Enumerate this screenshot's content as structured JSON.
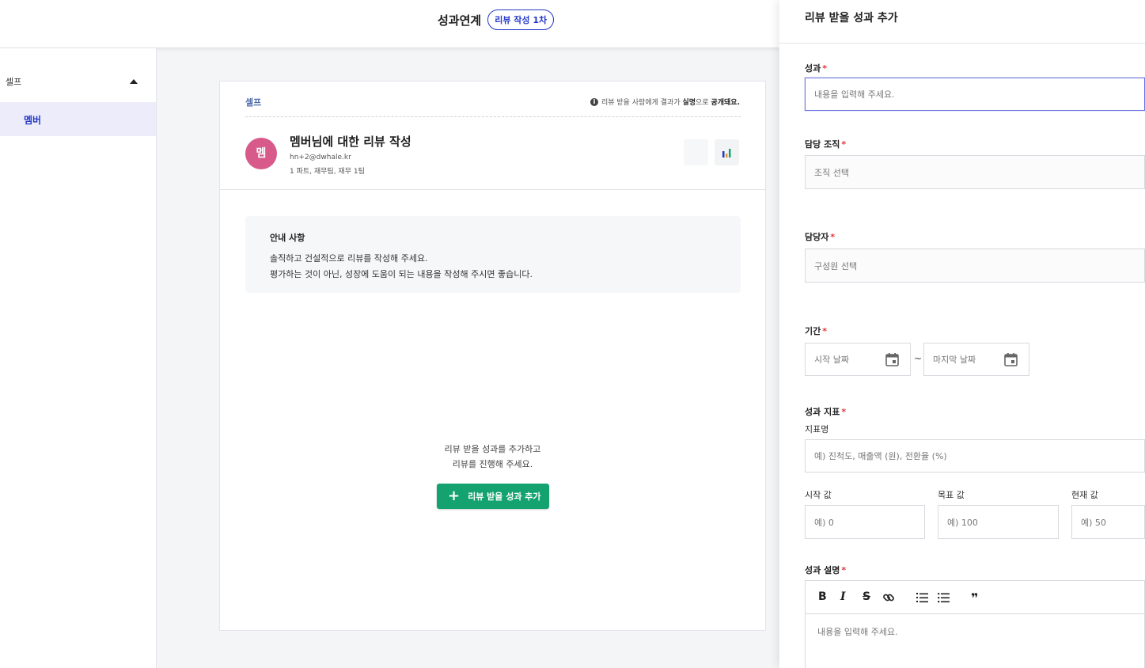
{
  "header": {
    "title": "성과연계",
    "badge": "리뷰 작성 1차"
  },
  "sidebar": {
    "group_label": "셀프",
    "items": [
      {
        "label": "멤버",
        "active": true
      }
    ]
  },
  "review": {
    "tab_label": "셀프",
    "notice_prefix": "리뷰 받을 사람에게 결과가 ",
    "notice_bold1": "실명",
    "notice_mid": "으로 ",
    "notice_bold2": "공개돼요.",
    "avatar_text": "멤",
    "avatar_color": "#d75a8a",
    "title": "멤버님에 대한 리뷰 작성",
    "email": "hn+2@dwhale.kr",
    "org": "1 파트, 재무팀, 재무 1팀",
    "guide": {
      "heading": "안내 사항",
      "line1": "솔직하고 건설적으로 리뷰를 작성해 주세요.",
      "line2": "평가하는 것이 아닌, 성장에 도움이 되는 내용을 작성해 주시면 좋습니다."
    },
    "empty_line1": "리뷰 받을 성과를 추가하고",
    "empty_line2": "리뷰를 진행해 주세요.",
    "add_button": "리뷰 받을 성과 추가",
    "accent_green": "#14a370"
  },
  "panel": {
    "title": "리뷰 받을 성과 추가",
    "achievement": {
      "label": "성과",
      "placeholder": "내용을 입력해 주세요."
    },
    "org": {
      "label": "담당 조직",
      "placeholder": "조직 선택"
    },
    "owner": {
      "label": "담당자",
      "placeholder": "구성원 선택"
    },
    "period": {
      "label": "기간",
      "start_placeholder": "시작 날짜",
      "end_placeholder": "마지막 날짜",
      "separator": "~"
    },
    "metric": {
      "label": "성과 지표",
      "name_label": "지표명",
      "name_placeholder": "예) 진척도, 매출액 (원), 전환율 (%)",
      "start_label": "시작 값",
      "start_placeholder": "예) 0",
      "target_label": "목표 값",
      "target_placeholder": "예) 100",
      "current_label": "현재 값",
      "current_placeholder": "예) 50"
    },
    "description": {
      "label": "성과 설명",
      "placeholder": "내용을 입력해 주세요.",
      "toolbar": {
        "bold": "B",
        "italic": "I",
        "strike": "S",
        "quote": "❞"
      }
    },
    "required_mark": "*",
    "focus_color": "#6a72e0",
    "required_color": "#e0363b"
  }
}
